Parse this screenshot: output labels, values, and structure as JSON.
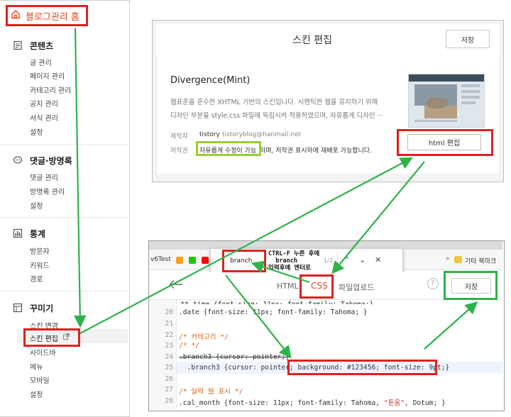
{
  "sidebar": {
    "home": "블로그관리 홈",
    "sections": [
      {
        "title": "콘텐츠",
        "icon": "document-icon",
        "items": [
          "글 관리",
          "페이지 관리",
          "카테고리 관리",
          "공지 관리",
          "서식 관리",
          "설정"
        ]
      },
      {
        "title": "댓글·방명록",
        "icon": "speech-bubble-icon",
        "items": [
          "댓글 관리",
          "방명록 관리",
          "설정"
        ]
      },
      {
        "title": "통계",
        "icon": "bar-chart-icon",
        "items": [
          "방문자",
          "키워드",
          "경로"
        ]
      },
      {
        "title": "꾸미기",
        "icon": "layout-icon",
        "items": [
          "스킨 변경",
          "스킨 편집",
          "사이드바",
          "메뉴",
          "모바일",
          "설정"
        ]
      }
    ]
  },
  "skin_panel": {
    "title": "스킨 편집",
    "save": "저장",
    "skin_name": "Divergence(Mint)",
    "desc_line1": "웹표준을 준수한 XHTML 기반의 스킨입니다. 시멘틱한 웹을 유지하기 위해",
    "desc_line2": "디자인 부분을 style.css 파일에 독립시켜 적용하였으며, 자유롭게 디자인 ···",
    "author_label": "제작자",
    "author_name": "tistory",
    "author_email": "tistoryblog@hanmail.net",
    "copyright_label": "저작권",
    "copyright_highlight": "자유롭게 수정이 가능",
    "copyright_rest": "하며, 저작권 표시하에 재배포 가능합니다.",
    "html_edit": "html 편집"
  },
  "editor": {
    "bookmarks": [
      "v6Test"
    ],
    "bookmark_right": "기타 북마크",
    "find_value": "branch",
    "find_count": "1/2",
    "annotation": [
      "CTRL-F 누른 후에",
      "  branch",
      "입력후에 엔터로"
    ],
    "tabs": {
      "html": "HTML",
      "css": "CSS",
      "upload": "파일업로드"
    },
    "help": "?",
    "save": "저장",
    "lines": [
      {
        "n": "20",
        "text": ".date {font-size: 11px; font-family: Tahoma; }"
      },
      {
        "n": "21",
        "text": ""
      },
      {
        "n": "22",
        "text": "/* 카테고리 */"
      },
      {
        "n": "23",
        "text": "/* */"
      },
      {
        "n": "24",
        "text": ".branch3 {cursor: pointer;}"
      },
      {
        "n": "25",
        "text_a": "  .branch3 {cursor: pointer; ",
        "text_b": "background: #123456; font-size: 9pt;",
        "text_c": "}"
      },
      {
        "n": "26",
        "text": ""
      },
      {
        "n": "27",
        "text": "/* 달력 월 표시 */"
      },
      {
        "n": "28",
        "text_a": ".cal_month {font-size: 11px; font-family: Tahoma, ",
        "text_b": "\"돋움\"",
        "text_c": ", Dotum; }"
      }
    ]
  },
  "colors": {
    "accent": "#e8471d",
    "highlight_red": "#e02020",
    "highlight_green": "#2db34a",
    "lime": "#9acd32"
  }
}
